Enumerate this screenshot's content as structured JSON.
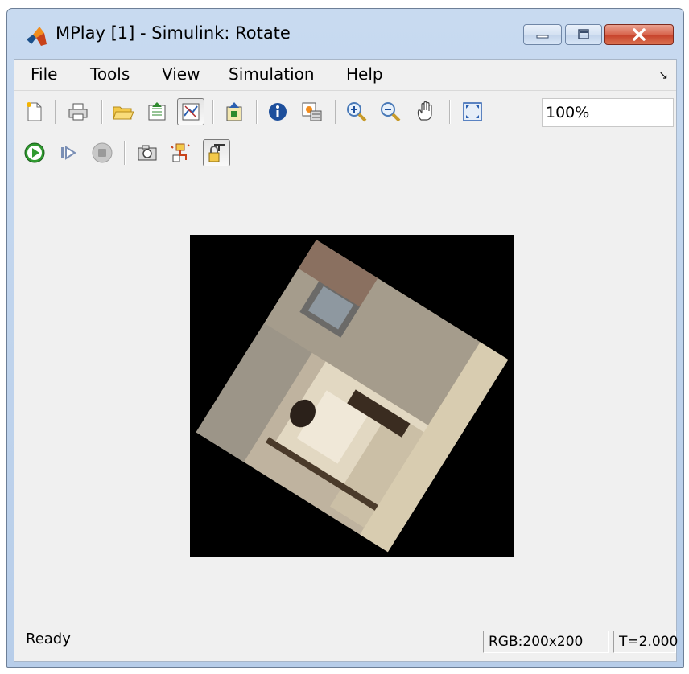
{
  "window": {
    "title": "MPlay [1] - Simulink: Rotate",
    "app_icon": "matlab-logo-icon",
    "caption_buttons": [
      "minimize-icon",
      "maximize-icon",
      "close-icon"
    ]
  },
  "menubar": {
    "items": [
      {
        "label": "File"
      },
      {
        "label": "Tools"
      },
      {
        "label": "View"
      },
      {
        "label": "Simulation"
      },
      {
        "label": "Help"
      }
    ],
    "overflow_icon": "menu-collapse-arrow-icon"
  },
  "toolbar1": {
    "buttons": [
      "new-icon",
      "print-icon",
      "open-file-icon",
      "export-icon",
      "connect-to-simulink-icon",
      "highlight-block-icon",
      "info-icon",
      "video-info-icon",
      "zoom-in-icon",
      "zoom-out-icon",
      "pan-hand-icon",
      "fit-to-view-icon"
    ],
    "zoom_value": "100%"
  },
  "toolbar2": {
    "buttons": [
      "play-icon",
      "step-forward-icon",
      "stop-icon",
      "snapshot-icon",
      "highlight-signal-icon",
      "persistent-lock-icon"
    ]
  },
  "video": {
    "description_colors": {
      "background": "#000000",
      "wall": "#b9ae9c",
      "floor": "#d6c9b2"
    }
  },
  "statusbar": {
    "status": "Ready",
    "format": "RGB:200x200",
    "time": "T=2.000"
  }
}
